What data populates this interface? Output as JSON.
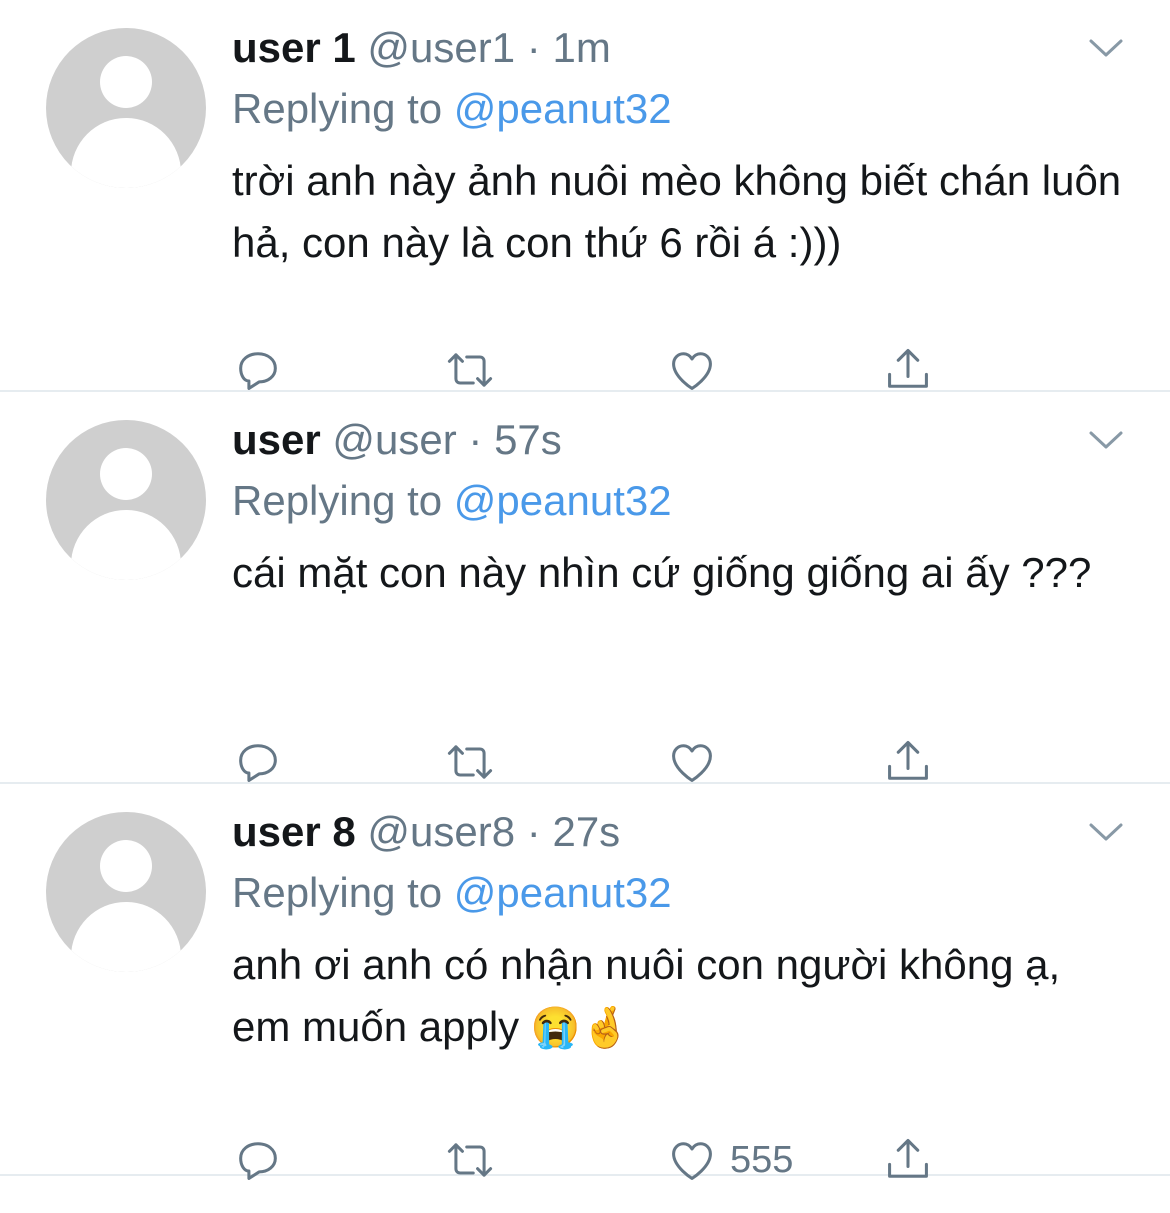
{
  "tweets": [
    {
      "name": "user 1",
      "handle": "@user1",
      "dot": "·",
      "time": "1m",
      "replying_prefix": "Replying to ",
      "replying_to": "@peanut32",
      "text": "trời anh này ảnh nuôi mèo không biết chán luôn hả, con này là con thứ 6 rồi á :)))",
      "like_count": ""
    },
    {
      "name": "user",
      "handle": "@user",
      "dot": "·",
      "time": "57s",
      "replying_prefix": "Replying to ",
      "replying_to": "@peanut32",
      "text": "cái mặt con này nhìn cứ giống giống ai ấy ???",
      "like_count": ""
    },
    {
      "name": "user 8",
      "handle": "@user8",
      "dot": "·",
      "time": "27s",
      "replying_prefix": "Replying to ",
      "replying_to": "@peanut32",
      "text": "anh ơi anh có nhận nuôi con người không ạ, em muốn apply",
      "emoji": "😭🤞",
      "like_count": "555"
    }
  ],
  "colors": {
    "link": "#4a99e9",
    "secondary": "#657786",
    "divider": "#e6ecf0"
  },
  "icons": [
    "reply-icon",
    "retweet-icon",
    "like-icon",
    "share-icon",
    "chevron-down-icon"
  ]
}
